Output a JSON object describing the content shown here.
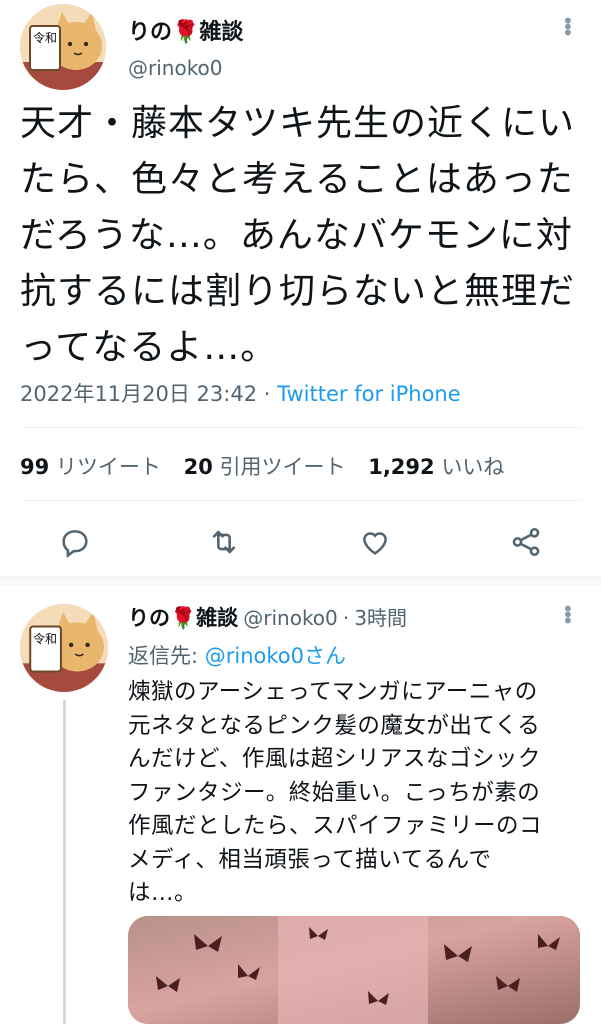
{
  "tweet": {
    "author_name": "りの🌹雑談",
    "author_handle": "@rinoko0",
    "avatar_badge": "令和",
    "text_lines": [
      "天才・藤本タツキ先生の近くにい",
      "たら、色々と考えることはあった",
      "だろうな…。あんなバケモンに対",
      "抗するには割り切らないと無理だ",
      "ってなるよ…。"
    ],
    "timestamp": "2022年11月20日 23:42",
    "separator": "·",
    "source": "Twitter for iPhone",
    "stats": {
      "retweets_count": "99",
      "retweets_label": "リツイート",
      "quotes_count": "20",
      "quotes_label": "引用ツイート",
      "likes_count": "1,292",
      "likes_label": "いいね"
    },
    "actions": {
      "reply_icon": "reply-icon",
      "retweet_icon": "retweet-icon",
      "like_icon": "heart-icon",
      "share_icon": "share-icon"
    }
  },
  "reply": {
    "author_name": "りの🌹雑談",
    "author_handle": "@rinoko0",
    "dot": "·",
    "time_ago": "3時間",
    "replying_prefix": "返信先: ",
    "replying_to": "@rinoko0さん",
    "avatar_badge": "令和",
    "text_lines": [
      "煉獄のアーシェってマンガにアーニャの",
      "元ネタとなるピンク髪の魔女が出てくる",
      "んだけど、作風は超シリアスなゴシック",
      "ファンタジー。終始重い。こっちが素の",
      "作風だとしたら、スパイファミリーのコ",
      "メディ、相当頑張って描いてるんで",
      "は…。"
    ]
  },
  "colors": {
    "text": "#0f1419",
    "secondary": "#536471",
    "accent": "#1d9bf0",
    "divider": "#eff3f4"
  }
}
